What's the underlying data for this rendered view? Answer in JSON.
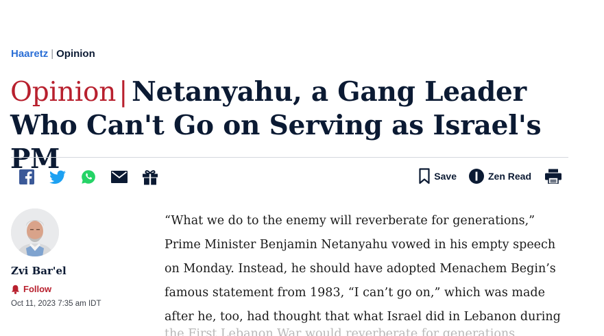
{
  "breadcrumb": {
    "site": "Haaretz",
    "separator": "|",
    "section": "Opinion"
  },
  "headline": {
    "kicker": "Opinion",
    "separator": "|",
    "title": "Netanyahu, a Gang Leader Who Can't Go on Serving as Israel's PM"
  },
  "share": {
    "items": [
      {
        "name": "facebook",
        "icon": "facebook-icon",
        "color": "#3b5998"
      },
      {
        "name": "twitter",
        "icon": "twitter-icon",
        "color": "#1da1f2"
      },
      {
        "name": "whatsapp",
        "icon": "whatsapp-icon",
        "color": "#25d366"
      },
      {
        "name": "email",
        "icon": "mail-icon",
        "color": "#0b1a33"
      },
      {
        "name": "gift",
        "icon": "gift-icon",
        "color": "#0b1a33"
      }
    ]
  },
  "tools": {
    "save_label": "Save",
    "zen_label": "Zen Read",
    "print_icon": "printer-icon"
  },
  "author": {
    "name": "Zvi Bar'el",
    "follow_label": "Follow",
    "timestamp": "Oct 11, 2023 7:35 am IDT"
  },
  "article": {
    "paragraph": "“What we do to the enemy will reverberate for generations,” Prime Minister Benjamin Netanyahu vowed in his empty speech on Monday. Instead, he should have adopted Menachem Begin’s famous statement from 1983, “I can’t go on,” which was made after he, too, had thought that what Israel did in Lebanon during",
    "next_line": "the First Lebanon War would reverberate for generations."
  },
  "colors": {
    "brand_red": "#b8202e",
    "link_blue": "#2b6fd6",
    "ink": "#0b1a33"
  }
}
